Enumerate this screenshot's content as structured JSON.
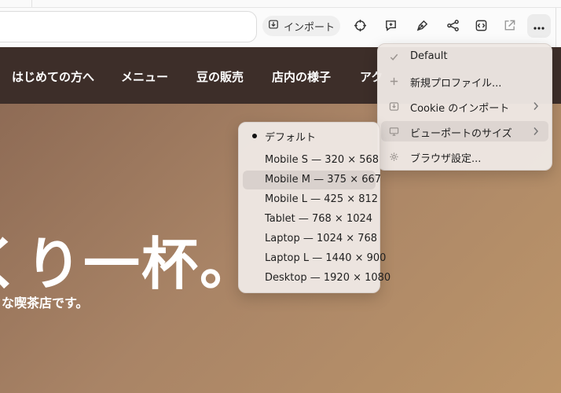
{
  "toolbar": {
    "import_label": "インポート"
  },
  "icons": {
    "import": "download-icon",
    "crosshair": "crosshair-icon",
    "comment": "add-comment-icon",
    "pen": "pen-icon",
    "share": "share-icon",
    "code": "code-icon",
    "external": "external-link-icon",
    "more": "more-icon"
  },
  "site": {
    "nav": [
      "はじめての方へ",
      "メニュー",
      "豆の販売",
      "店内の様子",
      "アク"
    ],
    "hero_title": "くり一杯。",
    "hero_subtitle": "さな喫茶店です。"
  },
  "main_menu": {
    "items": [
      {
        "label": "Default",
        "icon": "check-icon"
      },
      {
        "label": "新規プロファイル...",
        "icon": "plus-icon"
      },
      {
        "label": "Cookie のインポート",
        "icon": "download-icon",
        "submenu": true
      },
      {
        "label": "ビューポートのサイズ",
        "icon": "monitor-icon",
        "submenu": true,
        "active": true
      },
      {
        "label": "ブラウザ設定...",
        "icon": "gear-icon"
      }
    ]
  },
  "viewport_menu": {
    "items": [
      {
        "label": "デフォルト",
        "selected": true
      },
      {
        "label": "Mobile S — 320 × 568"
      },
      {
        "label": "Mobile M — 375 × 667",
        "active": true
      },
      {
        "label": "Mobile L — 425 × 812"
      },
      {
        "label": "Tablet — 768 × 1024"
      },
      {
        "label": "Laptop — 1024 × 768"
      },
      {
        "label": "Laptop L — 1440 × 900"
      },
      {
        "label": "Desktop — 1920 × 1080"
      }
    ]
  },
  "colors": {
    "nav_bg": "#3d2e29",
    "hero_start": "#8e6b55",
    "hero_end": "#bc956a",
    "menu_bg": "#eee8e4",
    "menu_active": "#ddd5d1"
  }
}
